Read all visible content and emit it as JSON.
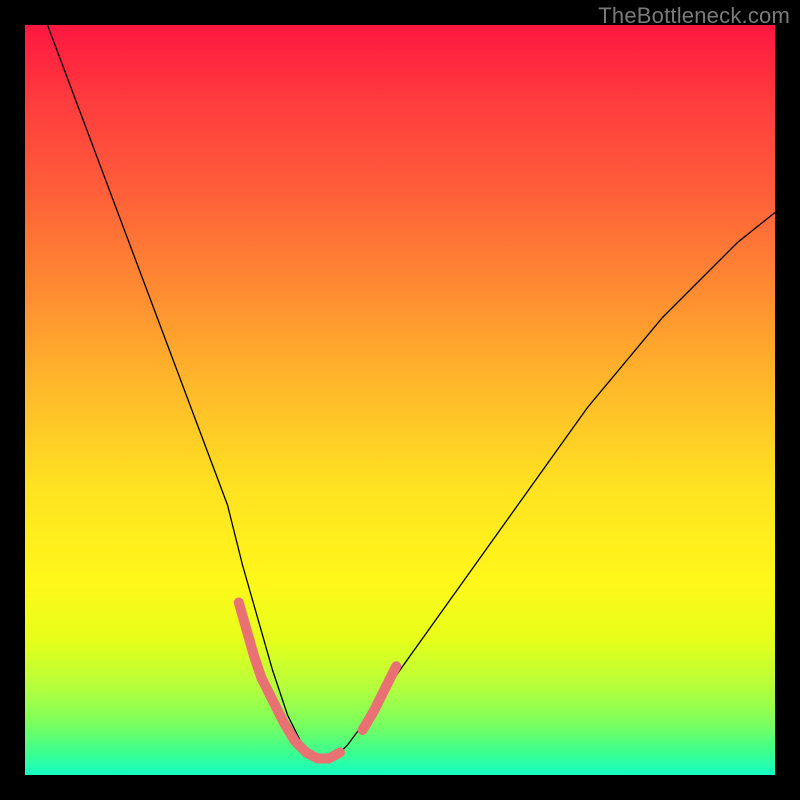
{
  "watermark": "TheBottleneck.com",
  "chart_data": {
    "type": "line",
    "title": "",
    "xlabel": "",
    "ylabel": "",
    "x_range": [
      0,
      100
    ],
    "y_range": [
      0,
      100
    ],
    "series": [
      {
        "name": "bottleneck-curve",
        "stroke": "#000000",
        "stroke_width": 1.3,
        "x": [
          3,
          6,
          9,
          12,
          15,
          18,
          21,
          24,
          27,
          29,
          31,
          33,
          35,
          37,
          39,
          41,
          43,
          46,
          50,
          55,
          60,
          65,
          70,
          75,
          80,
          85,
          90,
          95,
          100
        ],
        "y": [
          100,
          92,
          84,
          76,
          68,
          60,
          52,
          44,
          36,
          28,
          21,
          14,
          8,
          4,
          2,
          2,
          4,
          8,
          14,
          21,
          28,
          35,
          42,
          49,
          55,
          61,
          66,
          71,
          75
        ]
      }
    ],
    "marker_segments": [
      {
        "name": "left-pink-segment",
        "stroke": "#e97174",
        "stroke_width": 10,
        "cap": "round",
        "x": [
          28.5,
          29.5,
          30.5,
          31.5,
          33.0,
          34.5,
          36.0,
          37.5,
          39.0,
          40.5,
          42.0
        ],
        "y": [
          23.0,
          19.5,
          16.0,
          13.0,
          10.0,
          7.0,
          4.5,
          3.0,
          2.2,
          2.2,
          3.0
        ]
      },
      {
        "name": "right-pink-segment",
        "stroke": "#e97174",
        "stroke_width": 10,
        "cap": "round",
        "x": [
          45.0,
          46.5,
          48.0,
          49.5
        ],
        "y": [
          6.0,
          8.5,
          11.5,
          14.5
        ]
      }
    ]
  }
}
